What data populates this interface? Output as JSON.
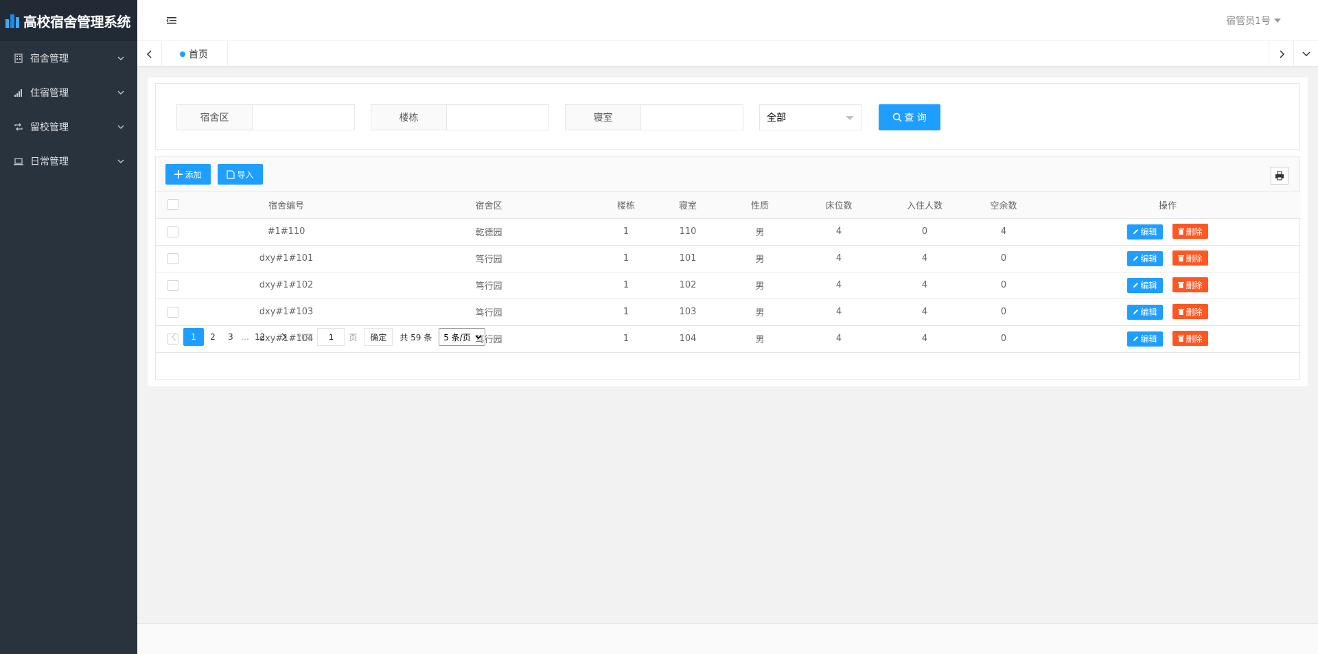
{
  "app": {
    "title": "高校宿舍管理系统"
  },
  "sidebar": {
    "items": [
      {
        "label": "宿舍管理",
        "icon": "building-icon"
      },
      {
        "label": "住宿管理",
        "icon": "signal-icon"
      },
      {
        "label": "留校管理",
        "icon": "refresh-icon"
      },
      {
        "label": "日常管理",
        "icon": "laptop-icon"
      }
    ]
  },
  "header": {
    "user": "宿管员1号"
  },
  "tabs": {
    "home": "首页"
  },
  "search": {
    "area_label": "宿舍区",
    "building_label": "楼栋",
    "room_label": "寝室",
    "select_value": "全部",
    "query_label": "查 询"
  },
  "toolbar": {
    "add_label": "添加",
    "import_label": "导入"
  },
  "table": {
    "columns": [
      "宿舍编号",
      "宿舍区",
      "楼栋",
      "寝室",
      "性质",
      "床位数",
      "入住人数",
      "空余数",
      "操作"
    ],
    "rows": [
      [
        "#1#110",
        "乾德园",
        "1",
        "110",
        "男",
        "4",
        "0",
        "4"
      ],
      [
        "dxy#1#101",
        "笃行园",
        "1",
        "101",
        "男",
        "4",
        "4",
        "0"
      ],
      [
        "dxy#1#102",
        "笃行园",
        "1",
        "102",
        "男",
        "4",
        "4",
        "0"
      ],
      [
        "dxy#1#103",
        "笃行园",
        "1",
        "103",
        "男",
        "4",
        "4",
        "0"
      ],
      [
        "dxy#1#104",
        "笃行园",
        "1",
        "104",
        "男",
        "4",
        "4",
        "0"
      ]
    ],
    "edit_label": "编辑",
    "delete_label": "删除"
  },
  "pager": {
    "pages": [
      "1",
      "2",
      "3"
    ],
    "ellipsis": "…",
    "last": "12",
    "goto_prefix": "到第",
    "goto_value": "1",
    "goto_suffix": "页",
    "confirm": "确定",
    "total": "共 59 条",
    "page_size": "5 条/页"
  },
  "colors": {
    "primary": "#1e9fff",
    "danger": "#ff5722",
    "sidebar": "#28333e"
  }
}
